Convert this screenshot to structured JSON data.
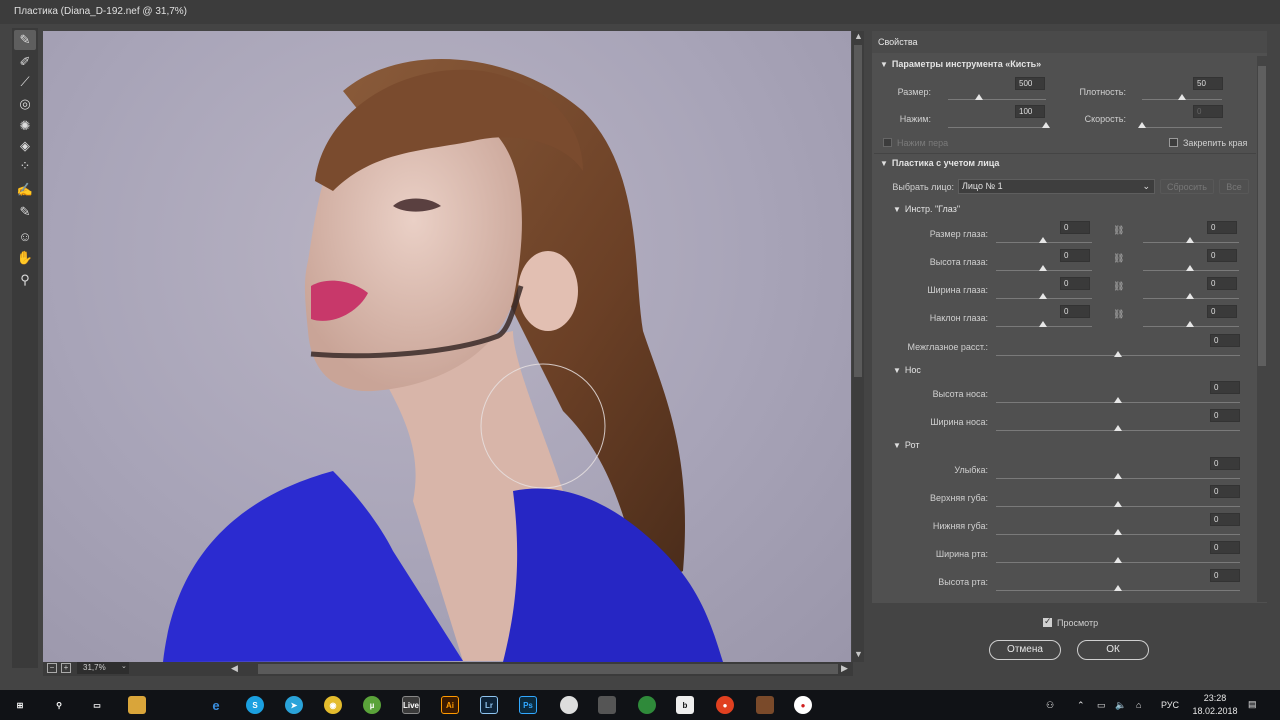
{
  "window": {
    "title": "Пластика (Diana_D-192.nef @ 31,7%)"
  },
  "tools": [
    "warp-brush-icon",
    "reconstruct-brush-icon",
    "smooth-brush-icon",
    "twirl-icon",
    "pucker-icon",
    "bloat-icon",
    "push-left-icon",
    "freeze-mask-icon",
    "thaw-mask-icon",
    "face-tool-icon",
    "hand-icon",
    "zoom-icon"
  ],
  "status": {
    "zoom": "31,7%"
  },
  "panel": {
    "title": "Свойства",
    "brush": {
      "heading": "Параметры инструмента «Кисть»",
      "size_label": "Размер:",
      "size_value": "500",
      "size_level": 0.2,
      "density_label": "Плотность:",
      "density_value": "50",
      "density_level": 0.5,
      "pressure_label": "Нажим:",
      "pressure_value": "100",
      "pressure_level": 1.0,
      "rate_label": "Скорость:",
      "rate_value": "0",
      "rate_level": 0,
      "stylus_label": "Нажим пера",
      "pin_edges_label": "Закрепить края"
    },
    "face": {
      "heading": "Пластика с учетом лица",
      "select_label": "Выбрать лицо:",
      "select_value": "Лицо № 1",
      "reset_label": "Сбросить",
      "all_label": "Все",
      "eyes": {
        "heading": "Инстр. \"Глаз\"",
        "rows": [
          {
            "label": "Размер глаза:",
            "left": "0",
            "right": "0"
          },
          {
            "label": "Высота глаза:",
            "left": "0",
            "right": "0"
          },
          {
            "label": "Ширина глаза:",
            "left": "0",
            "right": "0"
          },
          {
            "label": "Наклон глаза:",
            "left": "0",
            "right": "0"
          }
        ],
        "distance_label": "Межглазное расст.:",
        "distance_value": "0"
      },
      "nose": {
        "heading": "Нос",
        "rows": [
          {
            "label": "Высота носа:",
            "value": "0"
          },
          {
            "label": "Ширина носа:",
            "value": "0"
          }
        ]
      },
      "mouth": {
        "heading": "Рот",
        "rows": [
          {
            "label": "Улыбка:",
            "value": "0"
          },
          {
            "label": "Верхняя губа:",
            "value": "0"
          },
          {
            "label": "Нижняя губа:",
            "value": "0"
          },
          {
            "label": "Ширина рта:",
            "value": "0"
          },
          {
            "label": "Высота рта:",
            "value": "0"
          }
        ]
      }
    }
  },
  "footer": {
    "preview_label": "Просмотр",
    "cancel_label": "Отмена",
    "ok_label": "ОК"
  },
  "taskbar": {
    "apps": [
      "Ai",
      "Lr",
      "Ps",
      "Live"
    ],
    "lang": "РУС",
    "time": "23:28",
    "date": "18.02.2018"
  },
  "colors": {
    "accent": "#2b2bd0",
    "panel": "#505050"
  }
}
